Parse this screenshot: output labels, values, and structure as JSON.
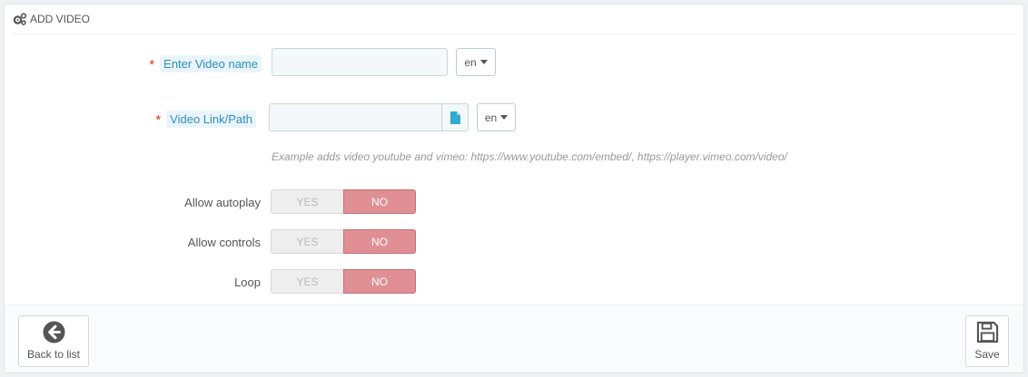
{
  "panel": {
    "title": "Add video",
    "heading_icon": "cogs-icon"
  },
  "form": {
    "video_name": {
      "required_mark": "*",
      "label": "Enter Video name",
      "value": "",
      "lang": "en"
    },
    "video_link": {
      "required_mark": "*",
      "label": "Video Link/Path",
      "value": "",
      "lang": "en",
      "file_icon": "file-icon",
      "help": "Example adds video youtube and vimeo: https://www.youtube.com/embed/, https://player.vimeo.com/video/"
    },
    "toggles": [
      {
        "label": "Allow autoplay",
        "yes": "YES",
        "no": "NO",
        "selected": "NO"
      },
      {
        "label": "Allow controls",
        "yes": "YES",
        "no": "NO",
        "selected": "NO"
      },
      {
        "label": "Loop",
        "yes": "YES",
        "no": "NO",
        "selected": "NO"
      }
    ]
  },
  "footer": {
    "back_label": "Back to list",
    "back_icon": "arrow-circle-left-icon",
    "save_label": "Save",
    "save_icon": "floppy-disk-icon"
  },
  "colors": {
    "required": "#e3302e",
    "label_hint_bg": "#eaf5fb",
    "label_hint_text": "#2c8ebf",
    "toggle_no_bg": "#e08f95",
    "file_icon": "#2eacce"
  }
}
